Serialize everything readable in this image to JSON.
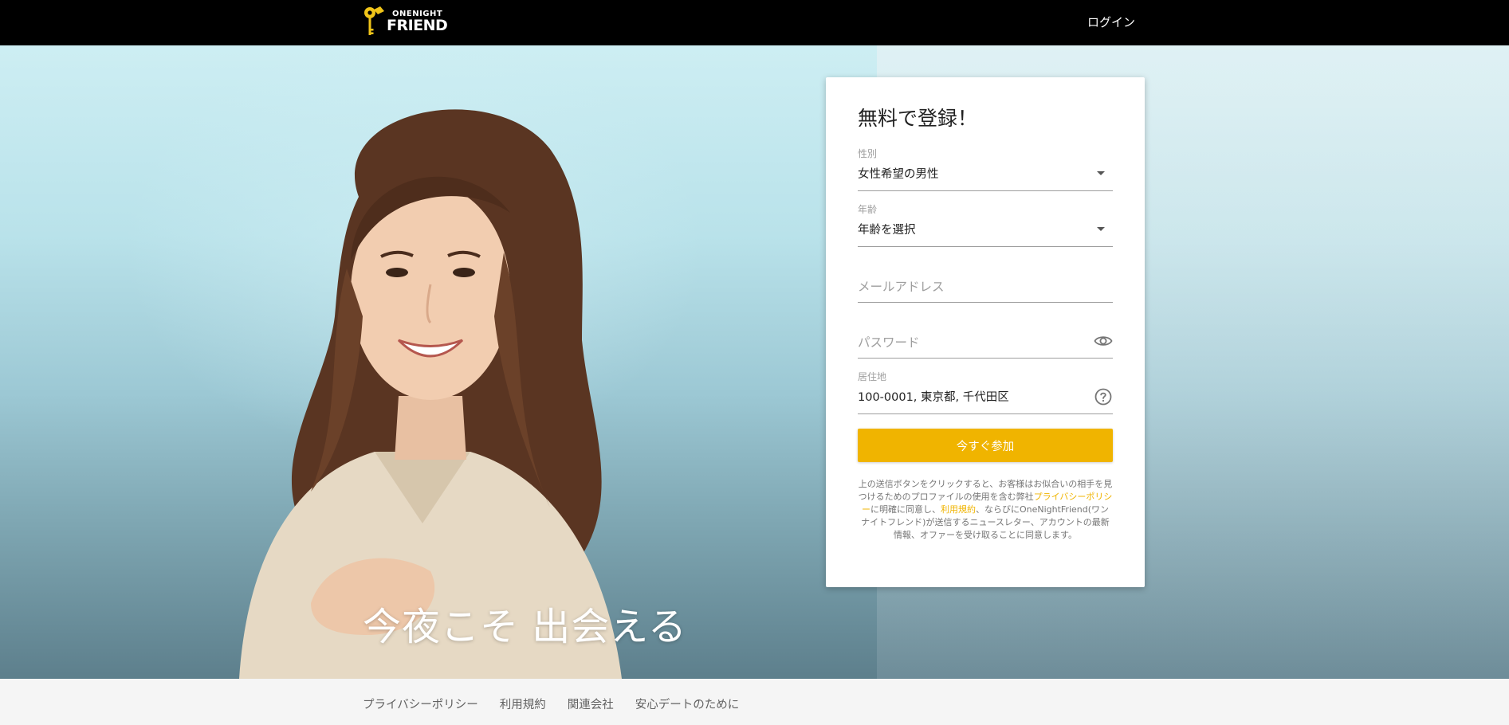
{
  "header": {
    "logo_top": "ONENIGHT",
    "logo_bottom": "FRIEND",
    "login_label": "ログイン"
  },
  "hero": {
    "tagline": "今夜こそ 出会える"
  },
  "signup": {
    "title": "無料で登録！",
    "gender": {
      "label": "性別",
      "value": "女性希望の男性"
    },
    "age": {
      "label": "年齢",
      "value": "年齢を選択"
    },
    "email": {
      "placeholder": "メールアドレス"
    },
    "password": {
      "placeholder": "パスワード"
    },
    "location": {
      "label": "居住地",
      "value": "100-0001, 東京都, 千代田区"
    },
    "join_label": "今すぐ参加",
    "terms": {
      "part1": "上の送信ボタンをクリックすると、お客様はお似合いの相手を見つけるためのプロファイルの使用を含む弊社",
      "privacy_link": "プライバシーポリシー",
      "part2": "に明確に同意し、",
      "terms_link": "利用規約",
      "part3": "、ならびにOneNightFriend(ワンナイトフレンド)が送信するニュースレター、アカウントの最新情報、オファーを受け取ることに同意します。"
    }
  },
  "footer": {
    "links": [
      "プライバシーポリシー",
      "利用規約",
      "関連会社",
      "安心デートのために"
    ]
  },
  "colors": {
    "accent": "#f0b400",
    "header_bg": "#000000",
    "footer_bg": "#f5f5f5"
  }
}
